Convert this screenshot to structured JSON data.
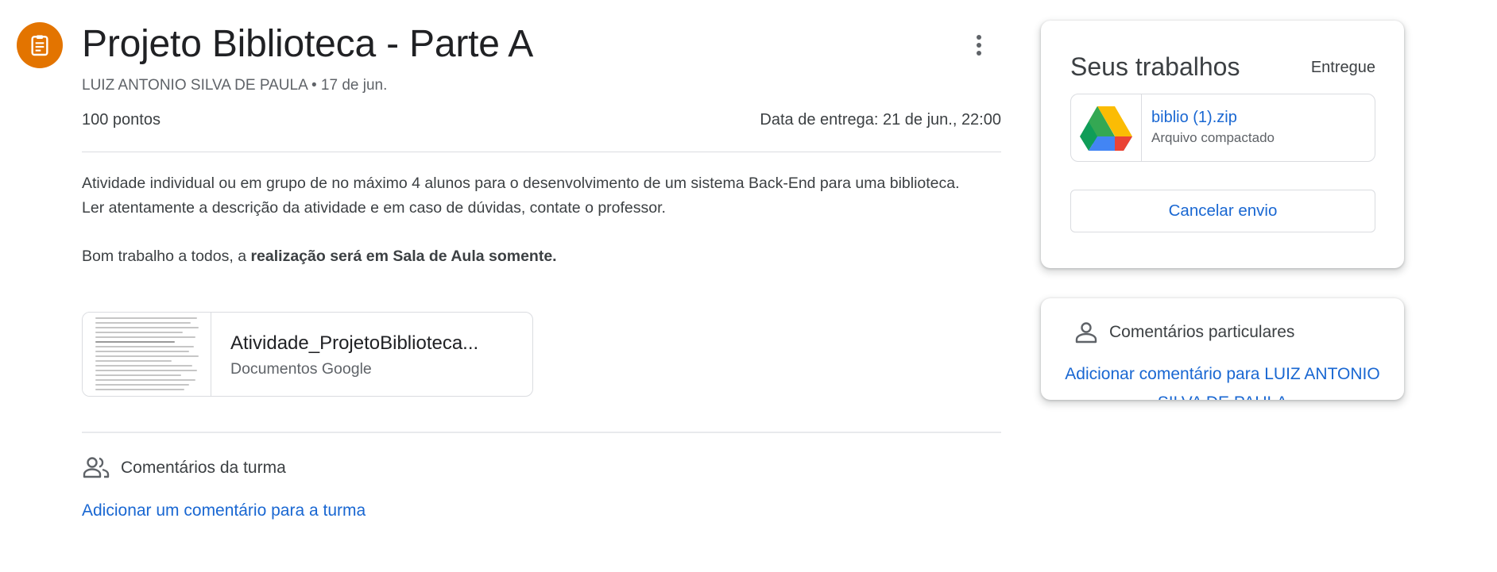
{
  "assignment": {
    "icon": "assignment-icon",
    "title": "Projeto Biblioteca - Parte A",
    "author": "LUIZ ANTONIO SILVA DE PAULA",
    "separator": "•",
    "posted_date": "17 de jun.",
    "points": "100 pontos",
    "due": "Data de entrega: 21 de jun., 22:00",
    "description": {
      "line1": "Atividade individual ou em grupo de no máximo 4 alunos para o desenvolvimento de um sistema Back-End para uma biblioteca.",
      "line2": "Ler atentamente a descrição da atividade e em caso de dúvidas, contate o professor.",
      "line3_prefix": "Bom trabalho a todos, a ",
      "line3_bold": "realização será em Sala de Aula somente."
    },
    "attachment": {
      "name": "Atividade_ProjetoBiblioteca...",
      "type": "Documentos Google"
    }
  },
  "class_comments": {
    "icon": "people-icon",
    "label": "Comentários da turma",
    "add_link": "Adicionar um comentário para a turma"
  },
  "your_work": {
    "title": "Seus trabalhos",
    "status": "Entregue",
    "file": {
      "icon": "google-drive-icon",
      "name": "biblio (1).zip",
      "type": "Arquivo compactado"
    },
    "cancel_label": "Cancelar envio"
  },
  "private_comments": {
    "icon": "person-icon",
    "label": "Comentários particulares",
    "add_link": "Adicionar comentário para LUIZ ANTONIO SILVA DE PAULA"
  },
  "colors": {
    "accent_orange": "#e37400",
    "link_blue": "#1967d2",
    "text": "#3c4043",
    "divider": "#dadce0"
  }
}
